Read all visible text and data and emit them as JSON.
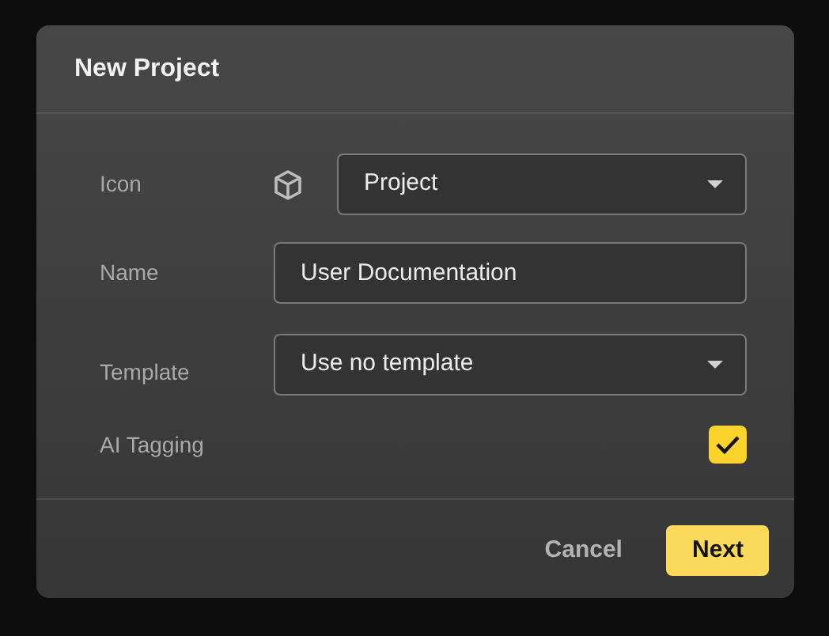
{
  "dialog": {
    "title": "New Project",
    "fields": [
      {
        "kind": "icon_select",
        "label": "Icon",
        "value": "Project"
      },
      {
        "kind": "text",
        "label": "Name",
        "value": "User Documentation"
      },
      {
        "kind": "select",
        "label": "Template",
        "value": "Use no template"
      },
      {
        "kind": "checkbox",
        "label": "AI Tagging",
        "checked": true
      }
    ],
    "buttons": [
      {
        "label": "Cancel",
        "kind": "secondary"
      },
      {
        "label": "Next",
        "kind": "primary"
      }
    ]
  }
}
